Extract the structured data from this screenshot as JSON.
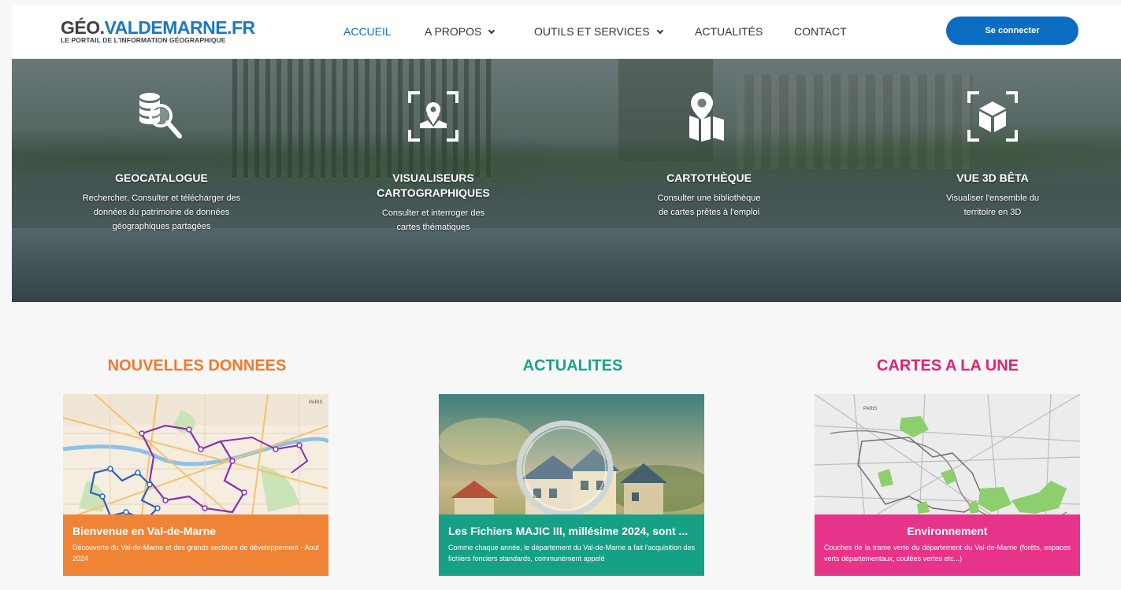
{
  "logo": {
    "main_part1": "GÉO.",
    "main_part2": "VALDEMARNE.FR",
    "subtitle": "LE PORTAIL DE L'INFORMATION GÉOGRAPHIQUE"
  },
  "nav": {
    "items": [
      {
        "label": "ACCUEIL",
        "active": true,
        "dropdown": false
      },
      {
        "label": "A PROPOS",
        "active": false,
        "dropdown": true
      },
      {
        "label": "OUTILS ET SERVICES",
        "active": false,
        "dropdown": true
      },
      {
        "label": "ACTUALITÉS",
        "active": false,
        "dropdown": false
      },
      {
        "label": "CONTACT",
        "active": false,
        "dropdown": false
      }
    ],
    "login_label": "Se connecter"
  },
  "hero": {
    "features": [
      {
        "icon": "database-search-icon",
        "title": "GEOCATALOGUE",
        "description": "Rechercher, Consulter et télécharger des données du patrimoine de données géographiques partagées"
      },
      {
        "icon": "map-viewer-icon",
        "title": "VISUALISEURS CARTOGRAPHIQUES",
        "description": "Consulter et interroger des cartes thématiques"
      },
      {
        "icon": "map-pin-icon",
        "title": "CARTOTHÈQUE",
        "description": "Consulter une bibliothèque de cartes prêtes à l'emploi"
      },
      {
        "icon": "cube-3d-icon",
        "title": "VUE 3D BÊTA",
        "description": "Visualiser l'ensemble du territoire en 3D"
      }
    ]
  },
  "sections": [
    {
      "title": "NOUVELLES DONNEES",
      "color": "#ee7a2f",
      "card": {
        "title": "Bienvenue en Val-de-Marne",
        "description": "Découverte du Val-de-Marne et des grands secteurs de développement - Aout 2024",
        "overlay_color": "#f08436",
        "map_label": "PARIS"
      }
    },
    {
      "title": "ACTUALITES",
      "color": "#1aa38a",
      "card": {
        "title": "Les Fichiers MAJIC III, millésime 2024, sont ...",
        "description": "Comme chaque année, le département du Val-de-Marne a fait l'acquisition des fichiers fonciers standards, communément appelé",
        "overlay_color": "#16a085"
      }
    },
    {
      "title": "CARTES A LA UNE",
      "color": "#e0226e",
      "card": {
        "title": "Environnement",
        "description": "Couches de la trame verte du département du Val-de-Marne (forêts, espaces verts départementaux, coulées vertes etc...)",
        "overlay_color": "#e8338a",
        "map_label": "PARIS"
      }
    }
  ]
}
